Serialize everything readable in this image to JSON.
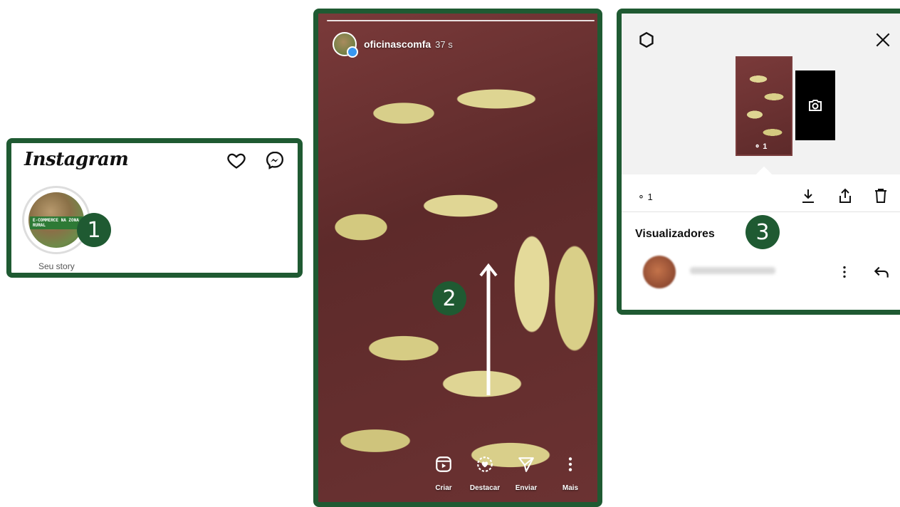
{
  "step_badges": [
    "1",
    "2",
    "3"
  ],
  "feed": {
    "logo": "Instagram",
    "icons": [
      "heart-icon",
      "messenger-icon"
    ],
    "story_avatar_text": "E-COMMERCE NA ZONA RURAL",
    "story_caption": "Seu story"
  },
  "story": {
    "username": "oficinascomfa",
    "time": "37 s",
    "progress": 1.0,
    "actions": [
      {
        "label": "Criar",
        "icon": "reels-icon"
      },
      {
        "label": "Destacar",
        "icon": "highlight-heart-icon"
      },
      {
        "label": "Enviar",
        "icon": "send-icon"
      },
      {
        "label": "Mais",
        "icon": "more-vertical-icon"
      }
    ]
  },
  "viewers_panel": {
    "thumb_count": "1",
    "view_count": "1",
    "title": "Visualizadores",
    "viewer_name": "",
    "icons": [
      "settings-icon",
      "close-icon",
      "camera-icon",
      "eye-icon",
      "download-icon",
      "share-icon",
      "trash-icon",
      "more-vertical-icon",
      "reply-icon"
    ]
  },
  "colors": {
    "frame_green": "#1f5a32",
    "badge_text": "#ffffff",
    "story_background": "#6a2c2c"
  }
}
